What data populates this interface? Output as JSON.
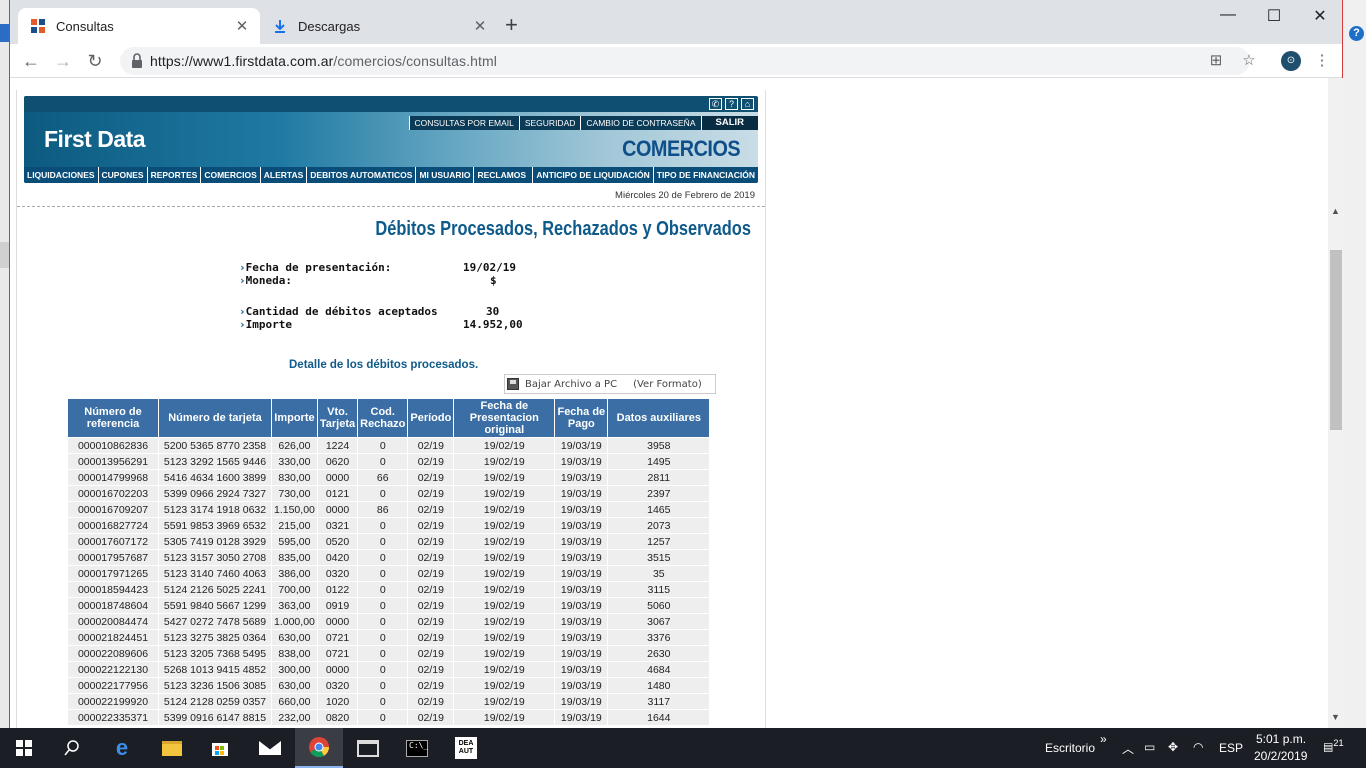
{
  "browser": {
    "tabs": [
      {
        "label": "Consultas",
        "active": true
      },
      {
        "label": "Descargas",
        "active": false
      }
    ],
    "new_tab": "+",
    "url_host": "https://www1.firstdata.com.ar",
    "url_path": "/comercios/consultas.html"
  },
  "header": {
    "logo": "First Data",
    "top_links": [
      "CONSULTAS POR EMAIL",
      "SEGURIDAD",
      "CAMBIO DE CONTRASEÑA",
      "SALIR"
    ],
    "section": "COMERCIOS",
    "nav": [
      "LIQUIDACIONES",
      "CUPONES",
      "REPORTES",
      "COMERCIOS",
      "ALERTAS",
      "DEBITOS AUTOMATICOS",
      "MI USUARIO",
      "RECLAMOS",
      "ANTICIPO DE LIQUIDACIÓN",
      "TIPO DE FINANCIACIÓN"
    ],
    "date": "Miércoles 20 de Febrero de 2019"
  },
  "page": {
    "title": "Débitos Procesados, Rechazados y Observados",
    "info": {
      "fecha_label": "Fecha de presentación:",
      "fecha_value": "19/02/19",
      "moneda_label": "Moneda:",
      "moneda_value": "$",
      "cantidad_label": "Cantidad de débitos aceptados",
      "cantidad_value": "30",
      "importe_label": "Importe",
      "importe_value": "14.952,00"
    },
    "detail_title": "Detalle de los débitos procesados.",
    "download_label": "Bajar Archivo a PC",
    "format_label": "(Ver Formato)"
  },
  "table": {
    "headers": [
      "Número de referencia",
      "Número de tarjeta",
      "Importe",
      "Vto. Tarjeta",
      "Cod. Rechazo",
      "Período",
      "Fecha de Presentacion original",
      "Fecha de Pago",
      "Datos auxiliares"
    ],
    "rows": [
      [
        "000010862836",
        "5200 5365 8770 2358",
        "626,00",
        "1224",
        "0",
        "02/19",
        "19/02/19",
        "19/03/19",
        "3958"
      ],
      [
        "000013956291",
        "5123 3292 1565 9446",
        "330,00",
        "0620",
        "0",
        "02/19",
        "19/02/19",
        "19/03/19",
        "1495"
      ],
      [
        "000014799968",
        "5416 4634 1600 3899",
        "830,00",
        "0000",
        "66",
        "02/19",
        "19/02/19",
        "19/03/19",
        "2811"
      ],
      [
        "000016702203",
        "5399 0966 2924 7327",
        "730,00",
        "0121",
        "0",
        "02/19",
        "19/02/19",
        "19/03/19",
        "2397"
      ],
      [
        "000016709207",
        "5123 3174 1918 0632",
        "1.150,00",
        "0000",
        "86",
        "02/19",
        "19/02/19",
        "19/03/19",
        "1465"
      ],
      [
        "000016827724",
        "5591 9853 3969 6532",
        "215,00",
        "0321",
        "0",
        "02/19",
        "19/02/19",
        "19/03/19",
        "2073"
      ],
      [
        "000017607172",
        "5305 7419 0128 3929",
        "595,00",
        "0520",
        "0",
        "02/19",
        "19/02/19",
        "19/03/19",
        "1257"
      ],
      [
        "000017957687",
        "5123 3157 3050 2708",
        "835,00",
        "0420",
        "0",
        "02/19",
        "19/02/19",
        "19/03/19",
        "3515"
      ],
      [
        "000017971265",
        "5123 3140 7460 4063",
        "386,00",
        "0320",
        "0",
        "02/19",
        "19/02/19",
        "19/03/19",
        "35"
      ],
      [
        "000018594423",
        "5124 2126 5025 2241",
        "700,00",
        "0122",
        "0",
        "02/19",
        "19/02/19",
        "19/03/19",
        "3115"
      ],
      [
        "000018748604",
        "5591 9840 5667 1299",
        "363,00",
        "0919",
        "0",
        "02/19",
        "19/02/19",
        "19/03/19",
        "5060"
      ],
      [
        "000020084474",
        "5427 0272 7478 5689",
        "1.000,00",
        "0000",
        "0",
        "02/19",
        "19/02/19",
        "19/03/19",
        "3067"
      ],
      [
        "000021824451",
        "5123 3275 3825 0364",
        "630,00",
        "0721",
        "0",
        "02/19",
        "19/02/19",
        "19/03/19",
        "3376"
      ],
      [
        "000022089606",
        "5123 3205 7368 5495",
        "838,00",
        "0721",
        "0",
        "02/19",
        "19/02/19",
        "19/03/19",
        "2630"
      ],
      [
        "000022122130",
        "5268 1013 9415 4852",
        "300,00",
        "0000",
        "0",
        "02/19",
        "19/02/19",
        "19/03/19",
        "4684"
      ],
      [
        "000022177956",
        "5123 3236 1506 3085",
        "630,00",
        "0320",
        "0",
        "02/19",
        "19/02/19",
        "19/03/19",
        "1480"
      ],
      [
        "000022199920",
        "5124 2128 0259 0357",
        "660,00",
        "1020",
        "0",
        "02/19",
        "19/02/19",
        "19/03/19",
        "3117"
      ],
      [
        "000022335371",
        "5399 0916 6147 8815",
        "232,00",
        "0820",
        "0",
        "02/19",
        "19/02/19",
        "19/03/19",
        "1644"
      ]
    ]
  },
  "taskbar": {
    "desktop_label": "Escritorio",
    "language": "ESP",
    "time": "5:01 p.m.",
    "date": "20/2/2019",
    "notification_count": "21"
  }
}
